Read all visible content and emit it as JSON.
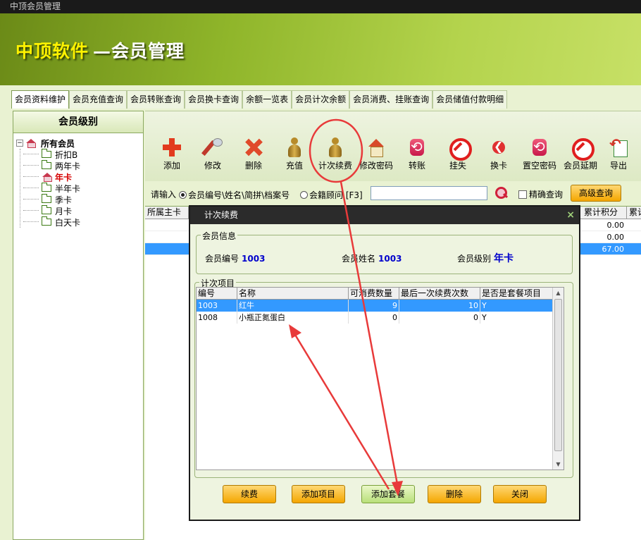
{
  "window": {
    "title": "中顶会员管理"
  },
  "banner": {
    "brand": "中顶软件",
    "subtitle": "—会员管理"
  },
  "tabs": [
    {
      "label": "会员资料维护",
      "active": true
    },
    {
      "label": "会员充值查询"
    },
    {
      "label": "会员转账查询"
    },
    {
      "label": "会员换卡查询"
    },
    {
      "label": "余额一览表"
    },
    {
      "label": "会员计次余额"
    },
    {
      "label": "会员消费、挂账查询"
    },
    {
      "label": "会员储值付款明细"
    }
  ],
  "sidebar": {
    "title": "会员级别",
    "root": "所有会员",
    "items": [
      {
        "label": "折扣B"
      },
      {
        "label": "两年卡"
      },
      {
        "label": "年卡",
        "selected": true
      },
      {
        "label": "半年卡"
      },
      {
        "label": "季卡"
      },
      {
        "label": "月卡"
      },
      {
        "label": "白天卡"
      }
    ]
  },
  "toolbar": {
    "add": "添加",
    "edit": "修改",
    "delete": "删除",
    "recharge": "充值",
    "count_renew": "计次续费",
    "change_password": "修改密码",
    "transfer": "转账",
    "report_loss": "挂失",
    "change_card": "换卡",
    "reset_password": "置空密码",
    "extend": "会员延期",
    "export": "导出"
  },
  "search": {
    "prompt": "请输入",
    "option1": "会员编号\\姓名\\简拼\\档案号",
    "option2": "会籍顾问 [F3]",
    "value": "",
    "exact": "精确查询",
    "advanced": "高级查询"
  },
  "grid": {
    "col_main_card": "所属主卡",
    "col_points": "累计积分",
    "col_more": "累计",
    "rows": [
      {
        "points": "0.00"
      },
      {
        "points": "0.00"
      },
      {
        "points": "67.00"
      }
    ]
  },
  "dialog": {
    "title": "计次续费",
    "close": "×",
    "member_info": {
      "legend": "会员信息",
      "id_label": "会员编号",
      "id_value": "1003",
      "name_label": "会员姓名",
      "name_value": "1003",
      "level_label": "会员级别",
      "level_value": "年卡"
    },
    "items": {
      "legend": "计次项目",
      "headers": [
        "编号",
        "名称",
        "可消费数量",
        "最后一次续费次数",
        "是否是套餐项目"
      ],
      "rows": [
        {
          "id": "1003",
          "name": "红牛",
          "qty": "9",
          "last": "10",
          "pkg": "Y"
        },
        {
          "id": "1008",
          "name": "小瓶正氮蛋白",
          "qty": "0",
          "last": "0",
          "pkg": "Y"
        }
      ]
    },
    "buttons": {
      "renew": "续费",
      "add_item": "添加项目",
      "add_package": "添加套餐",
      "delete": "删除",
      "close": "关闭"
    }
  }
}
